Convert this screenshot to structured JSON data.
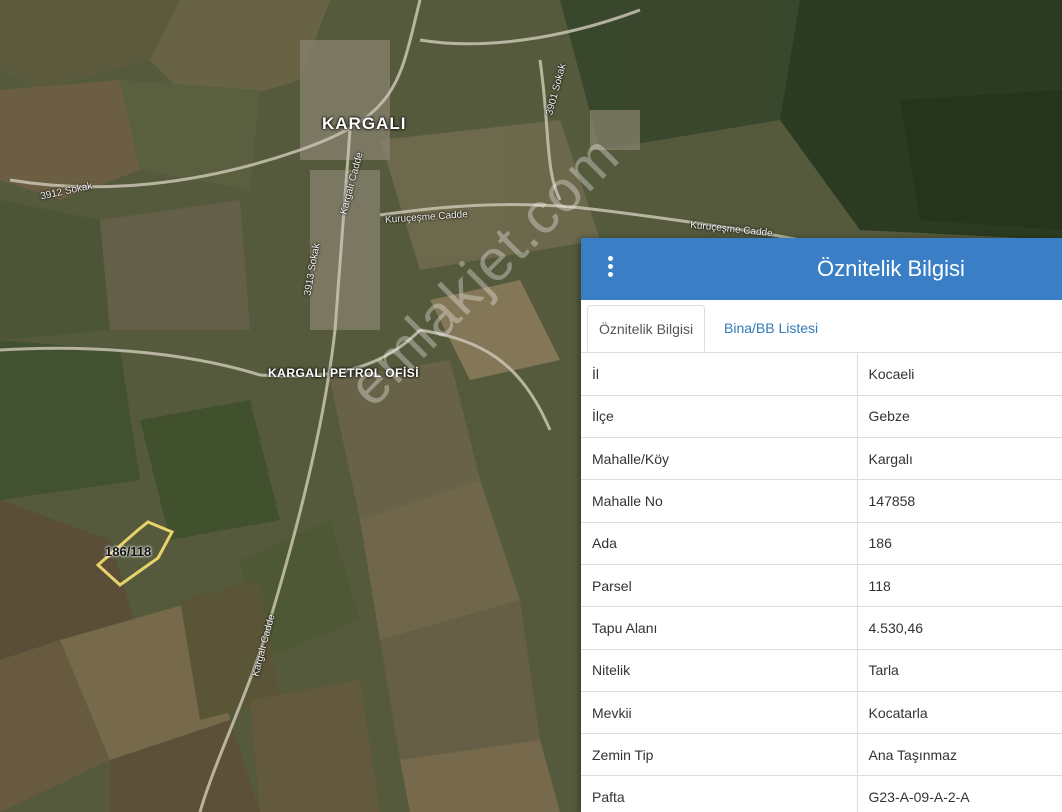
{
  "map": {
    "town_label": "KARGALI",
    "poi_label": "KARGALI PETROL OFİSİ",
    "road_labels": [
      "3912 Sokak",
      "Kargalı Cadde",
      "Kuruçeşme Cadde",
      "Kuruçeşme Cadde",
      "3913 Sokak",
      "3901 Sokak",
      "Kargalı Cadde"
    ],
    "parcel_label": "186/118",
    "parcel_outline_color": "#e8d36a",
    "watermark": "emlakjet.com"
  },
  "panel": {
    "header_color": "#3a7fc6",
    "menu_icon": "vertical-dots-icon",
    "title": "Öznitelik Bilgisi",
    "tabs": [
      {
        "label": "Öznitelik Bilgisi",
        "active": true
      },
      {
        "label": "Bina/BB Listesi",
        "active": false
      }
    ],
    "rows": [
      {
        "key": "İl",
        "value": "Kocaeli"
      },
      {
        "key": "İlçe",
        "value": "Gebze"
      },
      {
        "key": "Mahalle/Köy",
        "value": "Kargalı"
      },
      {
        "key": "Mahalle No",
        "value": "147858"
      },
      {
        "key": "Ada",
        "value": "186"
      },
      {
        "key": "Parsel",
        "value": "118"
      },
      {
        "key": "Tapu Alanı",
        "value": "4.530,46"
      },
      {
        "key": "Nitelik",
        "value": "Tarla"
      },
      {
        "key": "Mevkii",
        "value": "Kocatarla"
      },
      {
        "key": "Zemin Tip",
        "value": "Ana Taşınmaz"
      },
      {
        "key": "Pafta",
        "value": "G23-A-09-A-2-A"
      }
    ]
  }
}
